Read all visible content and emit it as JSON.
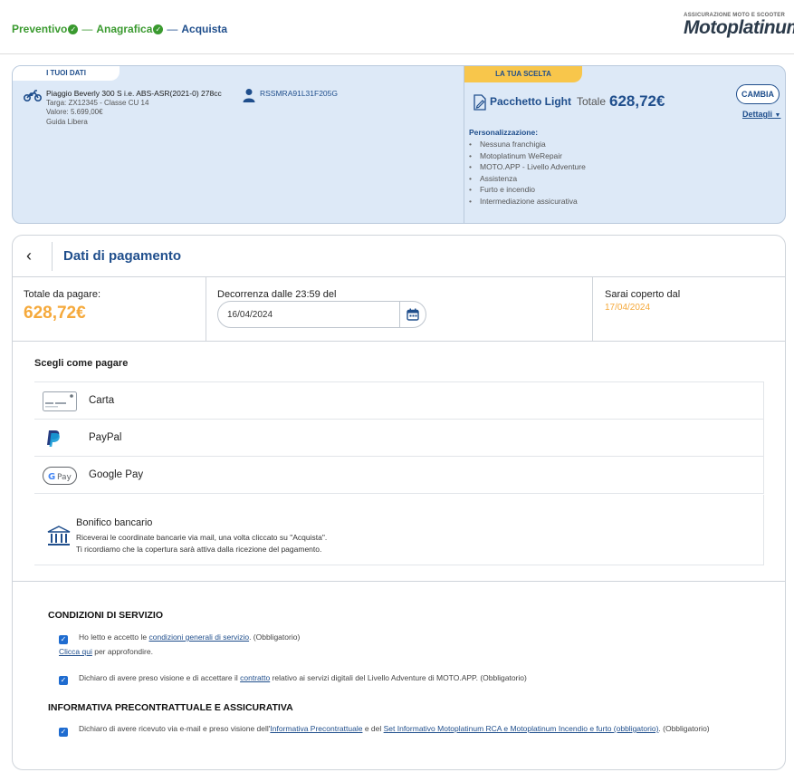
{
  "header": {
    "steps": [
      {
        "label": "Preventivo",
        "done": true
      },
      {
        "label": "Anagrafica",
        "done": true
      },
      {
        "label": "Acquista",
        "done": false
      }
    ],
    "logo_top": "ASSICURAZIONE MOTO E SCOOTER",
    "logo_main": "Motoplatinum"
  },
  "summary": {
    "your_data_tag": "I TUOI DATI",
    "vehicle_name": "Piaggio Beverly 300 S i.e. ABS-ASR(2021-0) 278cc",
    "vehicle_plate": "Targa: ZX12345 - Classe CU 14",
    "vehicle_value": "Valore: 5.699,00€",
    "vehicle_guide": "Guida Libera",
    "fiscal_code": "RSSMRA91L31F205G",
    "choice_tag": "LA TUA SCELTA",
    "package_name": "Pacchetto Light",
    "total_label": "Totale",
    "total_value": "628,72€",
    "change_button": "CAMBIA",
    "details_link": "Dettagli",
    "personalization_title": "Personalizzazione:",
    "personalization_items": [
      "Nessuna franchigia",
      "Motoplatinum WeRepair",
      "MOTO.APP - Livello Adventure",
      "Assistenza",
      "Furto e incendio",
      "Intermediazione assicurativa"
    ]
  },
  "payment": {
    "title": "Dati di pagamento",
    "total_label": "Totale da pagare:",
    "total_value": "628,72€",
    "start_label": "Decorrenza dalle 23:59 del",
    "start_date": "16/04/2024",
    "covered_label": "Sarai coperto dal",
    "covered_date": "17/04/2024",
    "choose_label": "Scegli come pagare",
    "methods": [
      {
        "label": "Carta",
        "icon": "card-icon"
      },
      {
        "label": "PayPal",
        "icon": "paypal-icon"
      },
      {
        "label": "Google Pay",
        "icon": "google-pay-icon"
      }
    ],
    "bank_transfer": {
      "title": "Bonifico bancario",
      "line1": "Riceverai le coordinate bancarie via mail, una volta cliccato su \"Acquista\".",
      "line2": "Ti ricordiamo che la copertura sarà attiva dalla ricezione del pagamento."
    }
  },
  "conditions": {
    "service_title": "CONDIZIONI DI SERVIZIO",
    "c1_prefix": "Ho letto e accetto le ",
    "c1_link": "condizioni generali di servizio",
    "c1_suffix": ". (Obbligatorio)",
    "more_link": "Clicca qui",
    "more_suffix": " per approfondire.",
    "c2_prefix": "Dichiaro di avere preso visione e di accettare il ",
    "c2_link": "contratto",
    "c2_suffix": " relativo ai servizi digitali del Livello Adventure di MOTO.APP. (Obbligatorio)",
    "precontract_title": "INFORMATIVA PRECONTRATTUALE E ASSICURATIVA",
    "c3_prefix": "Dichiaro di avere ricevuto via e-mail e preso visione dell'",
    "c3_link1": "Informativa Precontrattuale",
    "c3_mid": " e del ",
    "c3_link2": "Set Informativo Motoplatinum RCA e Motoplatinum Incendio e furto (obbligatorio)",
    "c3_suffix": ". (Obbligatorio)"
  },
  "colors": {
    "primary": "#1f4e8c",
    "success": "#3a9a2f",
    "accent": "#f5a93b",
    "summary_bg": "#dde9f7",
    "tag_yellow": "#f8c64b"
  }
}
